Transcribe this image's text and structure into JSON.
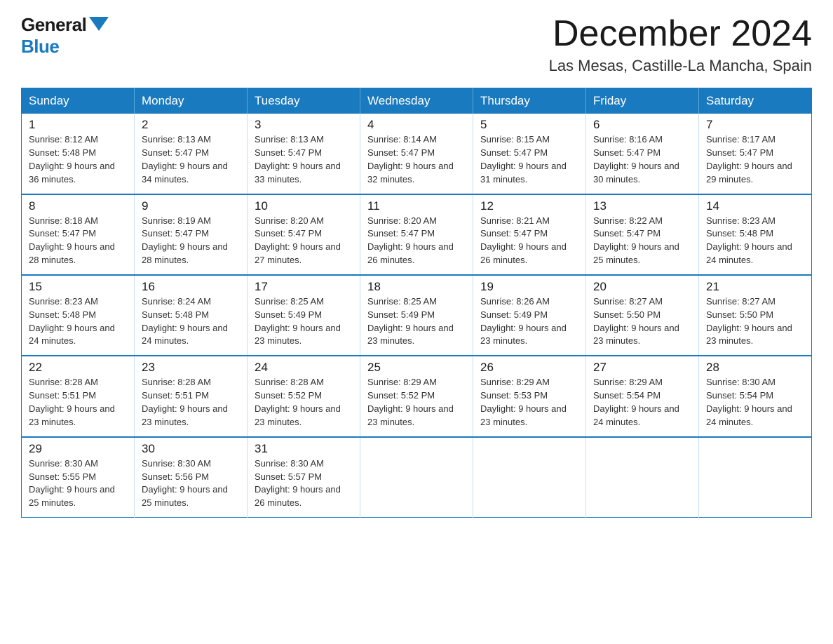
{
  "logo": {
    "general": "General",
    "blue": "Blue"
  },
  "title": "December 2024",
  "location": "Las Mesas, Castille-La Mancha, Spain",
  "weekdays": [
    "Sunday",
    "Monday",
    "Tuesday",
    "Wednesday",
    "Thursday",
    "Friday",
    "Saturday"
  ],
  "weeks": [
    [
      {
        "day": "1",
        "sunrise": "8:12 AM",
        "sunset": "5:48 PM",
        "daylight": "9 hours and 36 minutes."
      },
      {
        "day": "2",
        "sunrise": "8:13 AM",
        "sunset": "5:47 PM",
        "daylight": "9 hours and 34 minutes."
      },
      {
        "day": "3",
        "sunrise": "8:13 AM",
        "sunset": "5:47 PM",
        "daylight": "9 hours and 33 minutes."
      },
      {
        "day": "4",
        "sunrise": "8:14 AM",
        "sunset": "5:47 PM",
        "daylight": "9 hours and 32 minutes."
      },
      {
        "day": "5",
        "sunrise": "8:15 AM",
        "sunset": "5:47 PM",
        "daylight": "9 hours and 31 minutes."
      },
      {
        "day": "6",
        "sunrise": "8:16 AM",
        "sunset": "5:47 PM",
        "daylight": "9 hours and 30 minutes."
      },
      {
        "day": "7",
        "sunrise": "8:17 AM",
        "sunset": "5:47 PM",
        "daylight": "9 hours and 29 minutes."
      }
    ],
    [
      {
        "day": "8",
        "sunrise": "8:18 AM",
        "sunset": "5:47 PM",
        "daylight": "9 hours and 28 minutes."
      },
      {
        "day": "9",
        "sunrise": "8:19 AM",
        "sunset": "5:47 PM",
        "daylight": "9 hours and 28 minutes."
      },
      {
        "day": "10",
        "sunrise": "8:20 AM",
        "sunset": "5:47 PM",
        "daylight": "9 hours and 27 minutes."
      },
      {
        "day": "11",
        "sunrise": "8:20 AM",
        "sunset": "5:47 PM",
        "daylight": "9 hours and 26 minutes."
      },
      {
        "day": "12",
        "sunrise": "8:21 AM",
        "sunset": "5:47 PM",
        "daylight": "9 hours and 26 minutes."
      },
      {
        "day": "13",
        "sunrise": "8:22 AM",
        "sunset": "5:47 PM",
        "daylight": "9 hours and 25 minutes."
      },
      {
        "day": "14",
        "sunrise": "8:23 AM",
        "sunset": "5:48 PM",
        "daylight": "9 hours and 24 minutes."
      }
    ],
    [
      {
        "day": "15",
        "sunrise": "8:23 AM",
        "sunset": "5:48 PM",
        "daylight": "9 hours and 24 minutes."
      },
      {
        "day": "16",
        "sunrise": "8:24 AM",
        "sunset": "5:48 PM",
        "daylight": "9 hours and 24 minutes."
      },
      {
        "day": "17",
        "sunrise": "8:25 AM",
        "sunset": "5:49 PM",
        "daylight": "9 hours and 23 minutes."
      },
      {
        "day": "18",
        "sunrise": "8:25 AM",
        "sunset": "5:49 PM",
        "daylight": "9 hours and 23 minutes."
      },
      {
        "day": "19",
        "sunrise": "8:26 AM",
        "sunset": "5:49 PM",
        "daylight": "9 hours and 23 minutes."
      },
      {
        "day": "20",
        "sunrise": "8:27 AM",
        "sunset": "5:50 PM",
        "daylight": "9 hours and 23 minutes."
      },
      {
        "day": "21",
        "sunrise": "8:27 AM",
        "sunset": "5:50 PM",
        "daylight": "9 hours and 23 minutes."
      }
    ],
    [
      {
        "day": "22",
        "sunrise": "8:28 AM",
        "sunset": "5:51 PM",
        "daylight": "9 hours and 23 minutes."
      },
      {
        "day": "23",
        "sunrise": "8:28 AM",
        "sunset": "5:51 PM",
        "daylight": "9 hours and 23 minutes."
      },
      {
        "day": "24",
        "sunrise": "8:28 AM",
        "sunset": "5:52 PM",
        "daylight": "9 hours and 23 minutes."
      },
      {
        "day": "25",
        "sunrise": "8:29 AM",
        "sunset": "5:52 PM",
        "daylight": "9 hours and 23 minutes."
      },
      {
        "day": "26",
        "sunrise": "8:29 AM",
        "sunset": "5:53 PM",
        "daylight": "9 hours and 23 minutes."
      },
      {
        "day": "27",
        "sunrise": "8:29 AM",
        "sunset": "5:54 PM",
        "daylight": "9 hours and 24 minutes."
      },
      {
        "day": "28",
        "sunrise": "8:30 AM",
        "sunset": "5:54 PM",
        "daylight": "9 hours and 24 minutes."
      }
    ],
    [
      {
        "day": "29",
        "sunrise": "8:30 AM",
        "sunset": "5:55 PM",
        "daylight": "9 hours and 25 minutes."
      },
      {
        "day": "30",
        "sunrise": "8:30 AM",
        "sunset": "5:56 PM",
        "daylight": "9 hours and 25 minutes."
      },
      {
        "day": "31",
        "sunrise": "8:30 AM",
        "sunset": "5:57 PM",
        "daylight": "9 hours and 26 minutes."
      },
      null,
      null,
      null,
      null
    ]
  ]
}
